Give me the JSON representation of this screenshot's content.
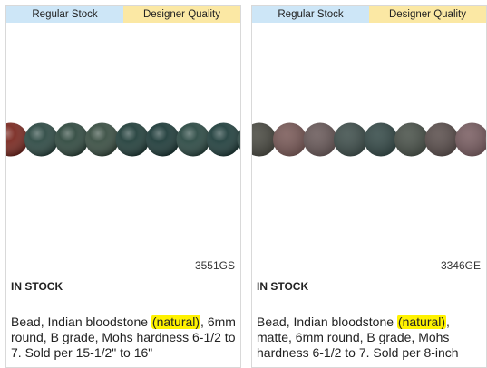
{
  "products": [
    {
      "tabs": {
        "regular": "Regular Stock",
        "designer": "Designer Quality"
      },
      "sku": "3551GS",
      "stock_status": "IN STOCK",
      "description": {
        "before": "Bead, Indian bloodstone ",
        "highlight": "(natural)",
        "after": ", 6mm round, B grade, Mohs hardness 6-1/2 to 7. Sold per 15-1/2\" to 16\""
      },
      "beads": [
        "#7a2a22",
        "#2e4a44",
        "#314a40",
        "#3a4f43",
        "#23403c",
        "#1f3c3a",
        "#2c4a44",
        "#22403e",
        "#2f4a46"
      ]
    },
    {
      "tabs": {
        "regular": "Regular Stock",
        "designer": "Designer Quality"
      },
      "sku": "3346GE",
      "stock_status": "IN STOCK",
      "description": {
        "before": "Bead, Indian bloodstone ",
        "highlight": "(natural)",
        "after": ", matte, 6mm round, B grade, Mohs hardness 6-1/2 to 7. Sold per 8-inch"
      },
      "beads": [
        "#4a4a42",
        "#7a5a58",
        "#6a5a5a",
        "#3f4f4c",
        "#354a48",
        "#4a524a",
        "#5b4f4d",
        "#7a5e62",
        "#8a6a6e",
        "#6a5458"
      ]
    }
  ]
}
